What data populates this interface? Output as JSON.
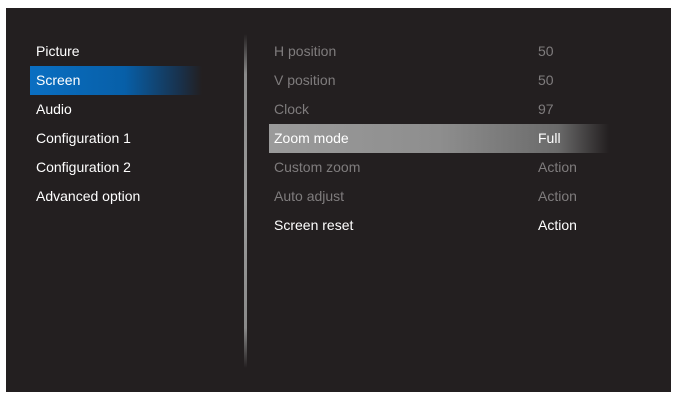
{
  "left_menu": {
    "items": [
      {
        "label": "Picture"
      },
      {
        "label": "Screen"
      },
      {
        "label": "Audio"
      },
      {
        "label": "Configuration 1"
      },
      {
        "label": "Configuration 2"
      },
      {
        "label": "Advanced option"
      }
    ],
    "selected": "Screen"
  },
  "right_menu": {
    "rows": [
      {
        "label": "H position",
        "value": "50"
      },
      {
        "label": "V position",
        "value": "50"
      },
      {
        "label": "Clock",
        "value": "97"
      },
      {
        "label": "Zoom mode",
        "value": "Full"
      },
      {
        "label": "Custom zoom",
        "value": "Action"
      },
      {
        "label": "Auto adjust",
        "value": "Action"
      },
      {
        "label": "Screen reset",
        "value": "Action"
      }
    ],
    "selected": "Zoom mode"
  },
  "colors": {
    "background": "#231f20",
    "left_selection": "#0a6fc2",
    "right_selection": "#9a9a9a",
    "text_enabled": "#ffffff",
    "text_disabled": "#7f7c7d"
  }
}
